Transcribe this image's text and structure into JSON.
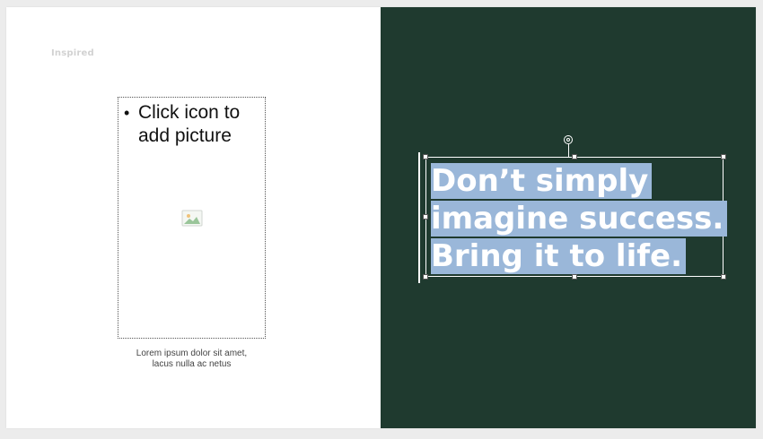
{
  "slide": {
    "brand_label": "Inspired",
    "picture_placeholder": {
      "bullet": "•",
      "prompt": "Click icon to add picture",
      "icon": "picture-icon"
    },
    "caption": {
      "line1": "Lorem ipsum dolor sit amet,",
      "line2": "lacus nulla ac netus"
    },
    "headline": {
      "line1": "Don’t simply",
      "line2": "imagine success.",
      "line3": "Bring it to life."
    }
  },
  "colors": {
    "right_panel_bg": "#1f3a2f",
    "selection_highlight": "#9ab7d9",
    "left_panel_bg": "#ffffff",
    "canvas_bg": "#ececec"
  }
}
